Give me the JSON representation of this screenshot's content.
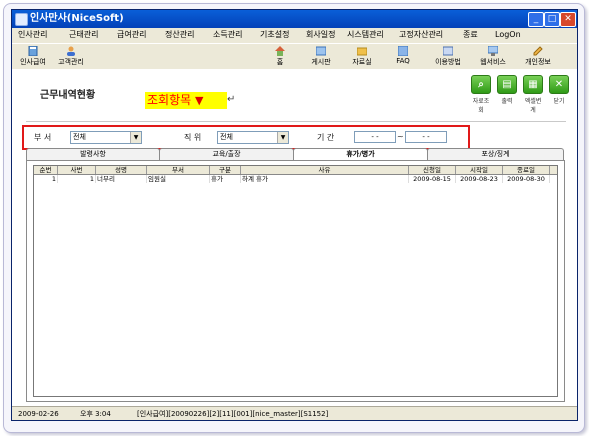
{
  "window": {
    "title": "인사만사(NiceSoft)"
  },
  "menu": [
    "인사관리",
    "근태관리",
    "급여관리",
    "정산관리",
    "소득관리",
    "기초설정",
    "회사일정",
    "시스템관리",
    "고정자산관리",
    "종료",
    "LogOn"
  ],
  "toolbar_left": [
    {
      "label": "인사급여",
      "icon": "calculator-icon"
    },
    {
      "label": "고객관리",
      "icon": "person-icon"
    }
  ],
  "toolbar_right": [
    {
      "label": "홈",
      "icon": "home-icon"
    },
    {
      "label": "게시판",
      "icon": "board-icon"
    },
    {
      "label": "자료실",
      "icon": "folder-icon"
    },
    {
      "label": "FAQ",
      "icon": "faq-icon"
    },
    {
      "label": "이용방법",
      "icon": "guide-icon"
    },
    {
      "label": "웹서비스",
      "icon": "web-icon"
    },
    {
      "label": "개인정보",
      "icon": "pencil-icon"
    }
  ],
  "page": {
    "title": "근무내역현황",
    "annotation": "조회항목",
    "annotation_mark": "▼",
    "return_mark": "↵"
  },
  "actions": [
    {
      "label": "자료조회",
      "icon": "search-icon"
    },
    {
      "label": "출력",
      "icon": "print-icon"
    },
    {
      "label": "엑셀변계",
      "icon": "excel-icon"
    },
    {
      "label": "닫기",
      "icon": "close-icon"
    }
  ],
  "filters": {
    "dept_label": "부   서",
    "dept_value": "전체",
    "rank_label": "직   위",
    "rank_value": "전체",
    "period_label": "기   간",
    "date_from": "- -",
    "date_sep": "~",
    "date_to": "- -"
  },
  "tabs": [
    "발령사항",
    "교육/출장",
    "휴가/병가",
    "포상/징계"
  ],
  "active_tab": 2,
  "table": {
    "columns": [
      "순번",
      "사번",
      "성명",
      "부서",
      "구분",
      "사유",
      "신청일",
      "시작일",
      "종료일"
    ],
    "rows": [
      [
        "1",
        "1",
        "너부리",
        "임원실",
        "휴가",
        "하계 휴가",
        "2009-08-15",
        "2009-08-23",
        "2009-08-30"
      ]
    ]
  },
  "status": {
    "date": "2009-02-26",
    "time": "오후 3:04",
    "info": "[인사급여][20090226][2][11][001][nice_master][S1152]"
  },
  "colors": {
    "highlight": "#ffff00",
    "annotation_text": "#ff0000",
    "frame_red": "#e11919",
    "titlebar": "#0a5fd8",
    "accent_green": "#2f9a16"
  }
}
